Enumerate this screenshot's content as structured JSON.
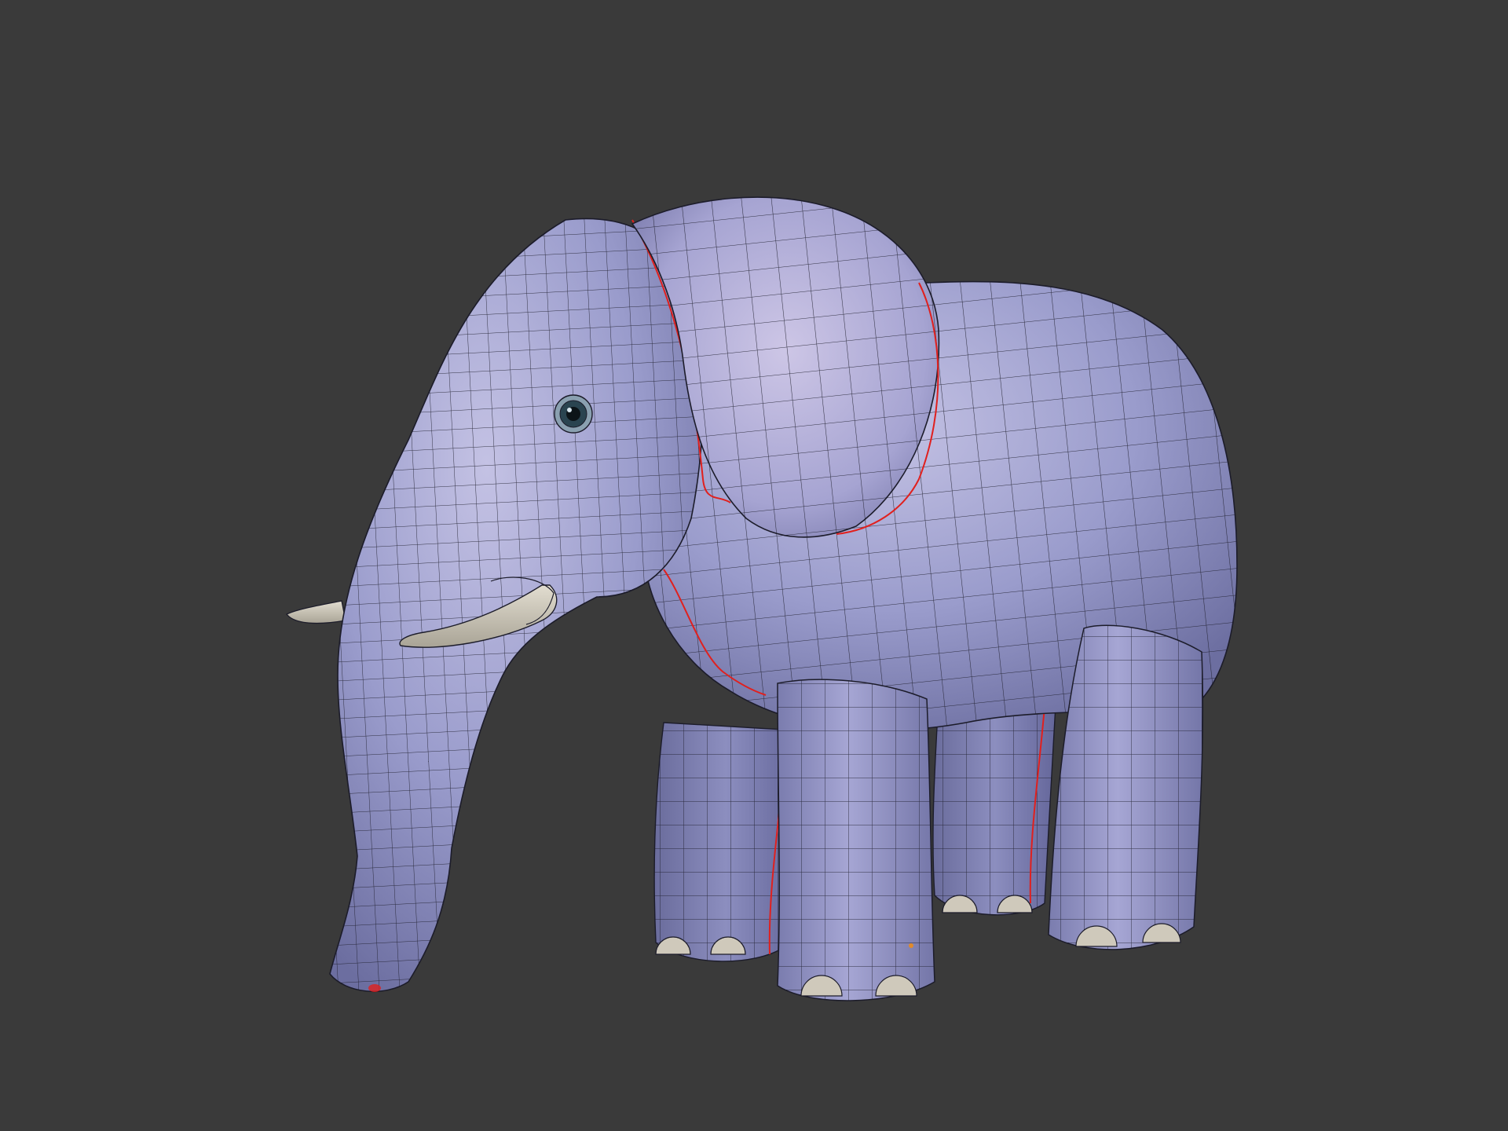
{
  "viewport": {
    "background_color": "#3a3a3a",
    "model": {
      "subject": "elephant",
      "display_mode": "solid-shaded-wireframe",
      "body_color": "#9a9ccc",
      "body_highlight_color": "#c4c2e4",
      "body_shadow_color": "#6c6ea0",
      "wire_color": "#1c1c2a",
      "seam_color": "#e0201e",
      "tusk_color": "#c9c4b6",
      "toenail_color": "#cfc9bb",
      "eye_color": "#1a2a30"
    }
  }
}
